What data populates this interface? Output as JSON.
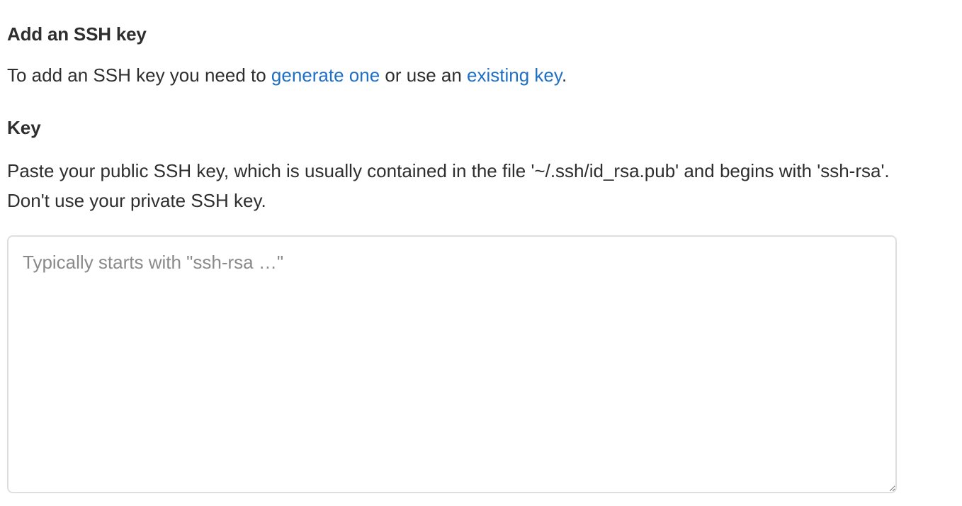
{
  "section": {
    "title": "Add an SSH key"
  },
  "intro": {
    "prefix": "To add an SSH key you need to ",
    "generate_link": "generate one",
    "middle": " or use an ",
    "existing_link": "existing key",
    "suffix": "."
  },
  "key_field": {
    "label": "Key",
    "help": "Paste your public SSH key, which is usually contained in the file '~/.ssh/id_rsa.pub' and begins with 'ssh-rsa'. Don't use your private SSH key.",
    "value": "",
    "placeholder": "Typically starts with \"ssh-rsa …\""
  },
  "colors": {
    "text": "#2e2e2e",
    "link": "#1f6fc5",
    "placeholder": "#8a8a8a",
    "input_border": "#dfdfdf"
  }
}
